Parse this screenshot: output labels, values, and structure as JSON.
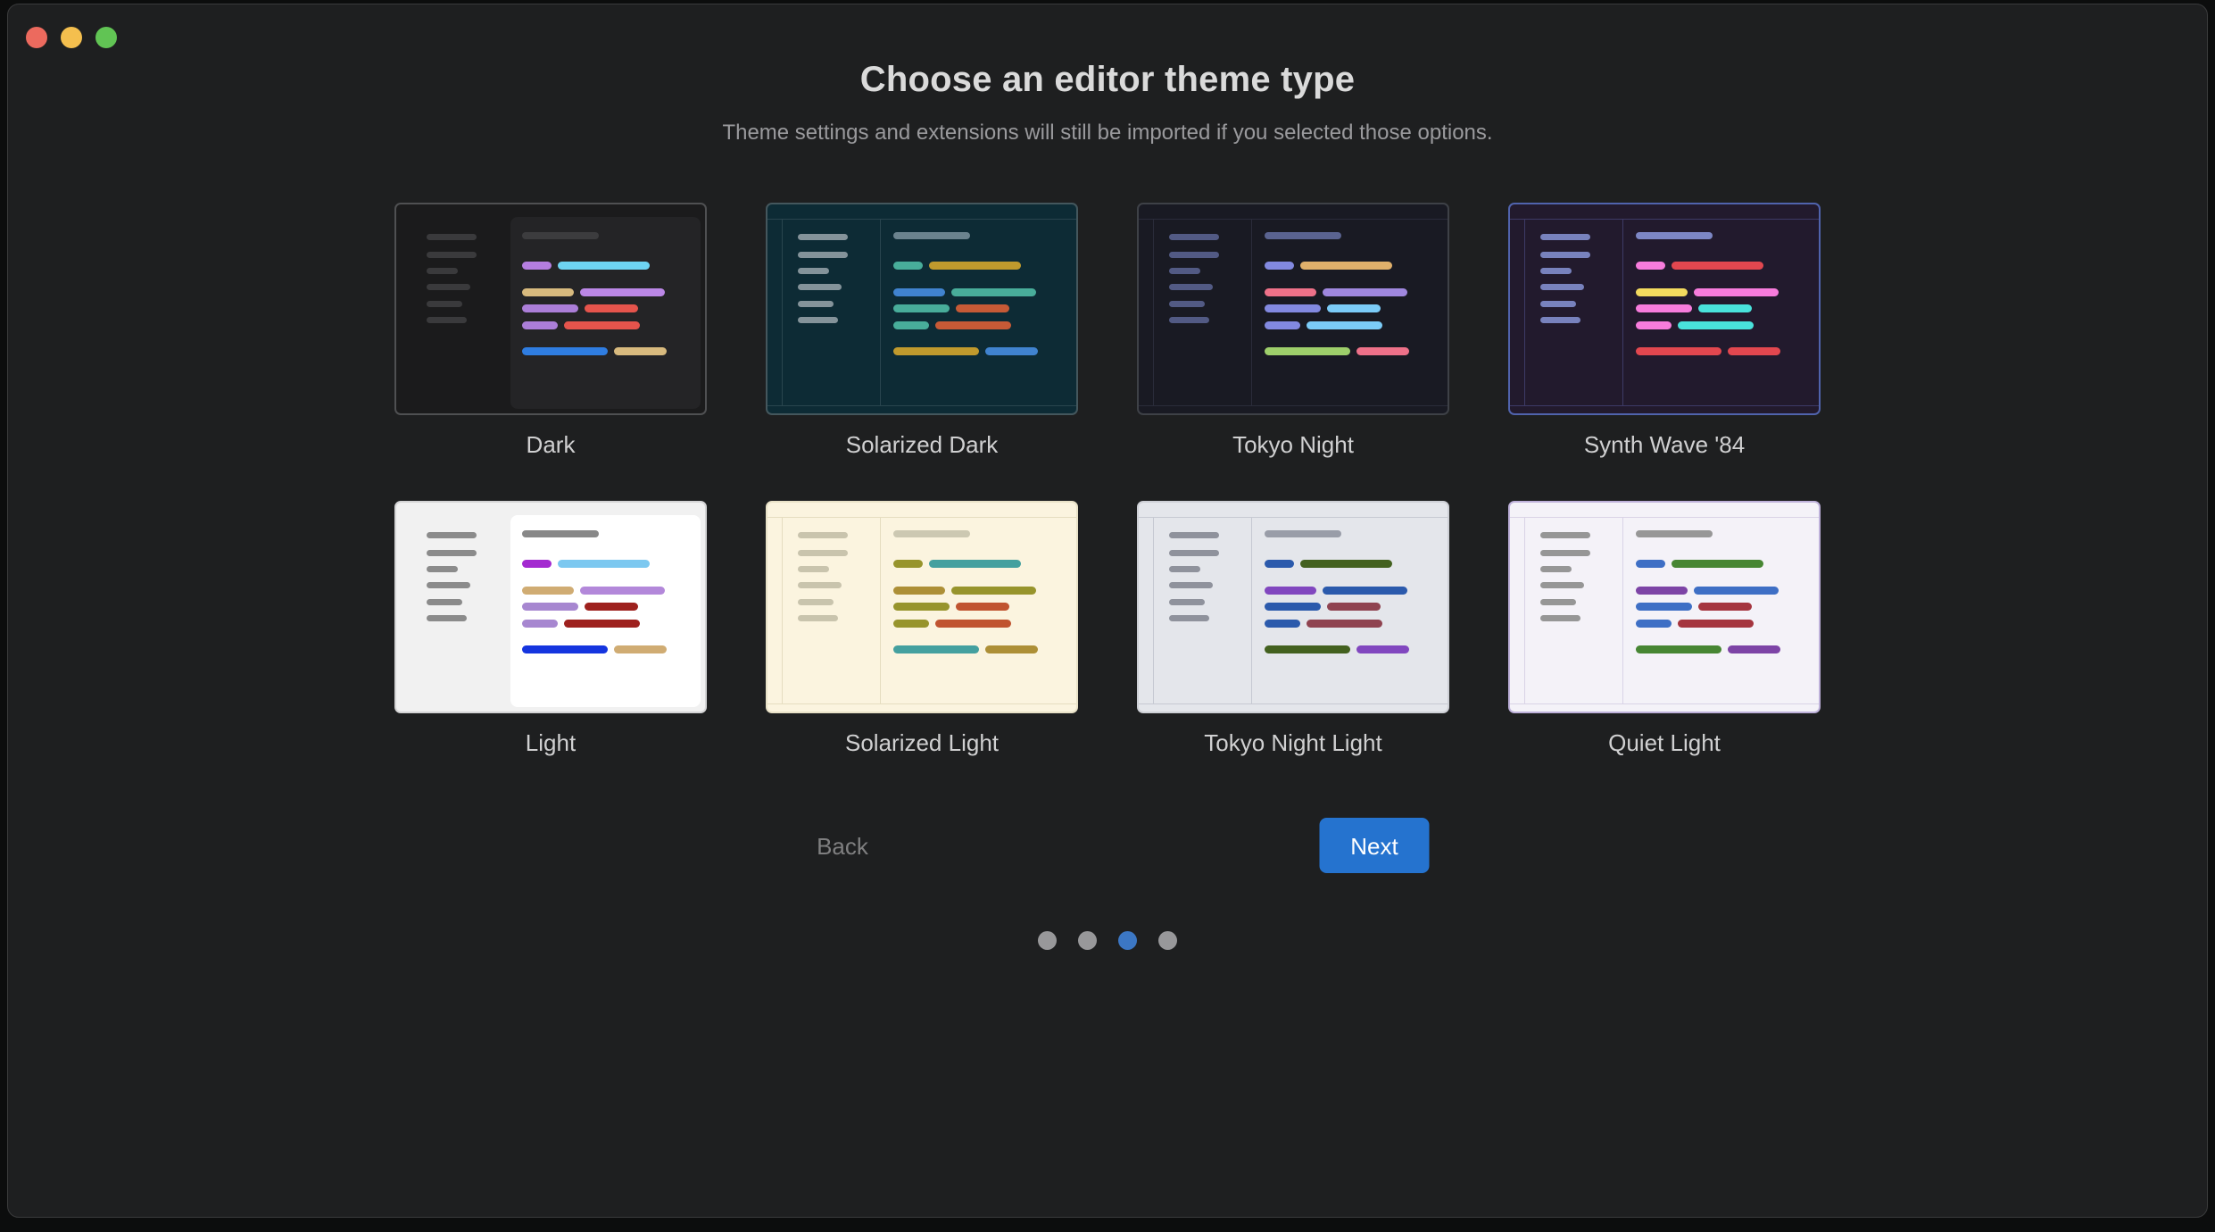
{
  "window_controls": {
    "close_color": "#ec6a5e",
    "minimize_color": "#f4bf4e",
    "zoom_color": "#61c454"
  },
  "header": {
    "title": "Choose an editor theme type",
    "subtitle": "Theme settings and extensions will still be imported if you selected those options."
  },
  "themes": [
    {
      "name": "Dark",
      "selected": false,
      "style": "panel",
      "palette": {
        "bg": "#1b1b1c",
        "panel": "#242426",
        "border": "#4f5052",
        "tree": "#3a3a3c",
        "heading": "#3c3c3e",
        "rows": [
          [
            "#b57ee0",
            "#6ed4f2"
          ],
          [
            "#d8ba7e",
            "#bb87e6"
          ],
          [
            "#ab7ed8",
            "#e5544c"
          ],
          [
            "#ab7ed8",
            "#e5544c"
          ],
          [
            "#2f7de1",
            "#d8ba7e"
          ]
        ]
      }
    },
    {
      "name": "Solarized Dark",
      "selected": false,
      "style": "chrome",
      "palette": {
        "bg": "#0d2b35",
        "border": "#44575d",
        "divider": "#29454e",
        "tree": "#84939a",
        "heading": "#6b838e",
        "rows": [
          [
            "#48ad9a",
            "#c09a2d"
          ],
          [
            "#4083cf",
            "#48ad9a"
          ],
          [
            "#48ad9a",
            "#c65a36"
          ],
          [
            "#48ad9a",
            "#c65a36"
          ],
          [
            "#c09a2d",
            "#4083cf"
          ]
        ]
      }
    },
    {
      "name": "Tokyo Night",
      "selected": false,
      "style": "chrome",
      "palette": {
        "bg": "#191a23",
        "border": "#3e4147",
        "divider": "#2a2c3a",
        "tree": "#525a84",
        "heading": "#5a6390",
        "rows": [
          [
            "#8289e0",
            "#e0b06b"
          ],
          [
            "#ee7189",
            "#9f87de"
          ],
          [
            "#8289e0",
            "#7bcbf7"
          ],
          [
            "#8289e0",
            "#7bcbf7"
          ],
          [
            "#9ecf6b",
            "#ee7189"
          ]
        ]
      }
    },
    {
      "name": "Synth Wave '84",
      "selected": true,
      "style": "chrome",
      "palette": {
        "bg": "#221a2d",
        "border": "#5063ad",
        "divider": "#3d3a66",
        "tree": "#7882bd",
        "heading": "#7d87c5",
        "rows": [
          [
            "#f77cdc",
            "#e2474f"
          ],
          [
            "#f3da5e",
            "#f77cdc"
          ],
          [
            "#f77cdc",
            "#49e2db"
          ],
          [
            "#f77cdc",
            "#49e2db"
          ],
          [
            "#e2474f",
            "#e2474f"
          ]
        ]
      }
    },
    {
      "name": "Light",
      "selected": false,
      "style": "panel",
      "palette": {
        "bg": "#f1f1f1",
        "panel": "#ffffff",
        "border": "#d4d4d5",
        "tree": "#8b8b8b",
        "heading": "#888888",
        "rows": [
          [
            "#a32ad0",
            "#7cc8f0"
          ],
          [
            "#d0ac73",
            "#b388da"
          ],
          [
            "#a787d0",
            "#9e211e"
          ],
          [
            "#a787d0",
            "#9e211e"
          ],
          [
            "#1535df",
            "#d0ac73"
          ]
        ]
      }
    },
    {
      "name": "Solarized Light",
      "selected": false,
      "style": "chrome",
      "palette": {
        "bg": "#fbf4df",
        "border": "#e9e2c8",
        "divider": "#e5ddc0",
        "tree": "#c9c4ad",
        "heading": "#ccc8b2",
        "rows": [
          [
            "#97942c",
            "#44a09f"
          ],
          [
            "#ad8f36",
            "#97942c"
          ],
          [
            "#97942c",
            "#c05430"
          ],
          [
            "#97942c",
            "#c05430"
          ],
          [
            "#44a09f",
            "#ad8f36"
          ]
        ]
      }
    },
    {
      "name": "Tokyo Night Light",
      "selected": false,
      "style": "chrome",
      "palette": {
        "bg": "#e4e6eb",
        "border": "#ced0d6",
        "divider": "#c6c9d2",
        "tree": "#8f929c",
        "heading": "#999da8",
        "rows": [
          [
            "#2b5aac",
            "#43611f"
          ],
          [
            "#8147bf",
            "#2b5aac"
          ],
          [
            "#2b5aac",
            "#8f4350"
          ],
          [
            "#2b5aac",
            "#8f4350"
          ],
          [
            "#43611f",
            "#8147bf"
          ]
        ]
      }
    },
    {
      "name": "Quiet Light",
      "selected": false,
      "style": "chrome",
      "palette": {
        "bg": "#f4f2f8",
        "border": "#beb1da",
        "divider": "#d9d3e6",
        "tree": "#969696",
        "heading": "#979797",
        "rows": [
          [
            "#3e6fc5",
            "#478633"
          ],
          [
            "#7d44a6",
            "#3e6fc5"
          ],
          [
            "#3e6fc5",
            "#a5353f"
          ],
          [
            "#3e6fc5",
            "#a5353f"
          ],
          [
            "#478633",
            "#7d44a6"
          ]
        ]
      }
    }
  ],
  "footer": {
    "back_label": "Back",
    "next_label": "Next",
    "next_button_color": "#2573cf"
  },
  "pagination": {
    "dot_count": 4,
    "active_index": 2,
    "active_color": "#3c77c4",
    "inactive_color": "#98989a"
  }
}
